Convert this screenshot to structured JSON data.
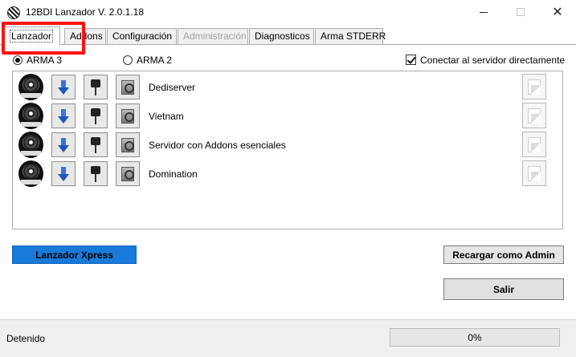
{
  "window": {
    "title": "12BDI Lanzador V. 2.0.1.18",
    "controls": {
      "minimize": "minimize",
      "maximize": "maximize",
      "close": "✕"
    }
  },
  "tabs": [
    {
      "label": "Lanzador",
      "active": true,
      "enabled": true
    },
    {
      "label": "Addons",
      "active": false,
      "enabled": true
    },
    {
      "label": "Configuración",
      "active": false,
      "enabled": true
    },
    {
      "label": "Administración",
      "active": false,
      "enabled": false
    },
    {
      "label": "Diagnosticos",
      "active": false,
      "enabled": true
    },
    {
      "label": "Arma STDERR",
      "active": false,
      "enabled": true
    }
  ],
  "game_select": {
    "options": [
      {
        "label": "ARMA 3",
        "selected": true
      },
      {
        "label": "ARMA 2",
        "selected": false
      }
    ],
    "direct_connect": {
      "label": "Conectar al servidor directamente",
      "checked": true
    }
  },
  "servers": [
    {
      "name": "Dediserver"
    },
    {
      "name": "Vietnam"
    },
    {
      "name": "Servidor con Addons esenciales"
    },
    {
      "name": "Domination"
    }
  ],
  "row_icons": [
    "server-logo-icon",
    "download-arrow-icon",
    "pin-icon",
    "settings-icon",
    "note-icon"
  ],
  "buttons": {
    "xpress": "Lanzador Xpress",
    "reload_admin": "Recargar como Admin",
    "exit": "Salir"
  },
  "status": {
    "text": "Detenido",
    "progress_label": "0%",
    "progress_value": 0
  },
  "colors": {
    "accent_blue": "#1a7ad9",
    "highlight_red": "#ff1010",
    "progress_green": "#06b025"
  }
}
